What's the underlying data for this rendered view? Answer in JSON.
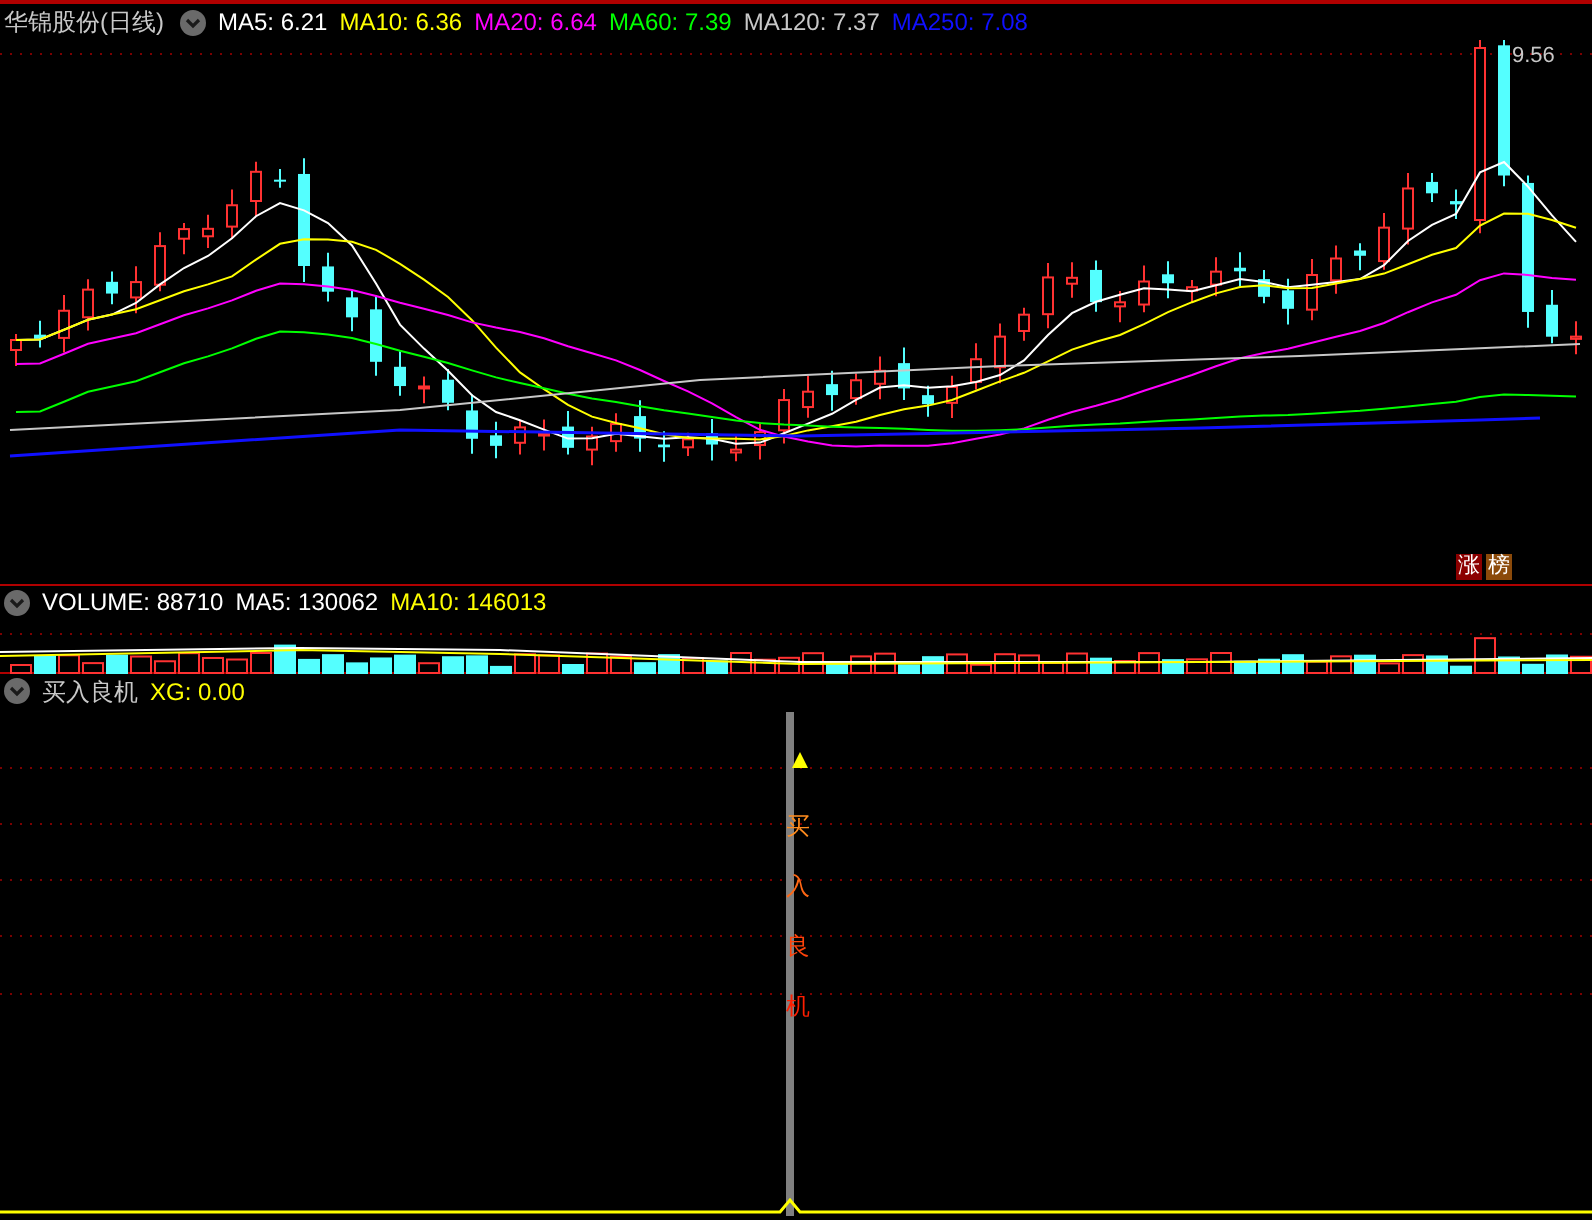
{
  "header": {
    "title": "华锦股份(日线)",
    "indicators": [
      {
        "label": "MA5: 6.21",
        "color": "#ffffff"
      },
      {
        "label": "MA10: 6.36",
        "color": "#ffff00"
      },
      {
        "label": "MA20: 6.64",
        "color": "#ff00ff"
      },
      {
        "label": "MA60: 7.39",
        "color": "#00ff00"
      },
      {
        "label": "MA120: 7.37",
        "color": "#c8c8c8"
      },
      {
        "label": "MA250: 7.08",
        "color": "#1010ff"
      }
    ]
  },
  "price_chart": {
    "high_label": "9.56",
    "badges": [
      {
        "text": "涨",
        "color": "#8b0000"
      },
      {
        "text": "榜",
        "color": "#8b4a0a"
      }
    ]
  },
  "volume_panel": {
    "indicators": [
      {
        "label": "VOLUME: 88710",
        "color": "#ffffff"
      },
      {
        "label": "MA5: 130062",
        "color": "#ffffff"
      },
      {
        "label": "MA10: 146013",
        "color": "#ffff00"
      }
    ]
  },
  "signal_panel": {
    "indicators": [
      {
        "label": "买入良机",
        "color": "#c8c8c8"
      },
      {
        "label": "XG: 0.00",
        "color": "#ffff00"
      }
    ],
    "signal_text": "买入良机"
  }
}
